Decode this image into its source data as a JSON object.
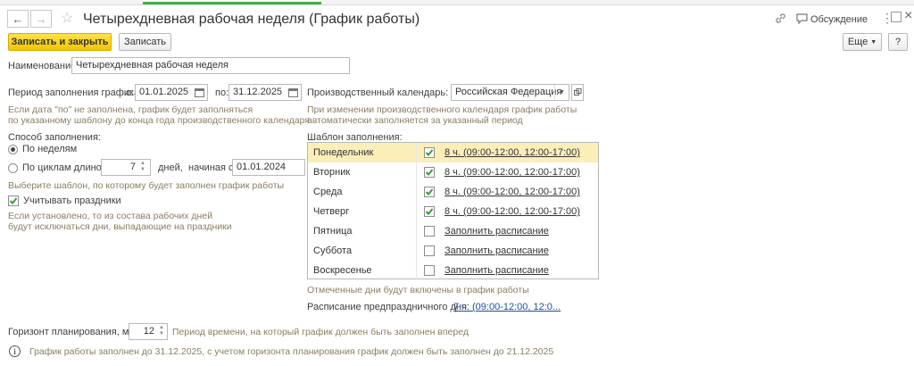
{
  "window": {
    "title": "Четырехдневная рабочая неделя (График работы)"
  },
  "header": {
    "discussion_label": "Обсуждение",
    "more_label": "Еще",
    "help_label": "?"
  },
  "toolbar": {
    "save_close_label": "Записать и закрыть",
    "save_label": "Записать"
  },
  "form": {
    "name_label": "Наименование:",
    "name_value": "Четырехдневная рабочая неделя",
    "period_label": "Период заполнения графика",
    "period_from_label": "с:",
    "period_from": "01.01.2025",
    "period_to_label": "по:",
    "period_to": "31.12.2025",
    "period_hint_1": "Если дата \"по\" не заполнена, график будет заполняться",
    "period_hint_2": "по указанному шаблону до конца года производственного календаря",
    "calendar_label": "Производственный календарь:",
    "calendar_value": "Российская Федерация",
    "calendar_hint_1": "При изменении производственного календаря график работы",
    "calendar_hint_2": "автоматически заполняется за указанный период",
    "method_label": "Способ заполнения:",
    "method_weeks": "По неделям",
    "method_cycles": "По циклам длиной",
    "cycle_length": "7",
    "cycle_days_label": "дней,",
    "cycle_start_label": "начиная с:",
    "cycle_start": "01.01.2024",
    "template_hint": "Выберите шаблон, по которому будет заполнен график работы",
    "holidays_label": "Учитывать праздники",
    "holidays_hint_1": "Если установлено, то из состава рабочих дней",
    "holidays_hint_2": "будут исключаться дни, выпадающие на праздники",
    "template_label": "Шаблон заполнения:",
    "marked_hint": "Отмеченные дни будут включены в график работы",
    "preholiday_label": "Расписание предпраздничного дня:",
    "preholiday_value": "7 ч. (09:00-12:00, 12:0...",
    "horizon_label": "Горизонт планирования, мес.:",
    "horizon_value": "12",
    "horizon_hint": "Период времени, на который график должен быть заполнен вперед",
    "info_text": "График работы заполнен до 31.12.2025, с учетом горизонта планирования график должен быть заполнен до 21.12.2025"
  },
  "schedule": [
    {
      "day": "Понедельник",
      "checked": true,
      "text": "8 ч. (09:00-12:00, 12:00-17:00)"
    },
    {
      "day": "Вторник",
      "checked": true,
      "text": "8 ч. (09:00-12:00, 12:00-17:00)"
    },
    {
      "day": "Среда",
      "checked": true,
      "text": "8 ч. (09:00-12:00, 12:00-17:00)"
    },
    {
      "day": "Четверг",
      "checked": true,
      "text": "8 ч. (09:00-12:00, 12:00-17:00)"
    },
    {
      "day": "Пятница",
      "checked": false,
      "text": "Заполнить расписание"
    },
    {
      "day": "Суббота",
      "checked": false,
      "text": "Заполнить расписание"
    },
    {
      "day": "Воскресенье",
      "checked": false,
      "text": "Заполнить расписание"
    }
  ],
  "colors": {
    "accent_yellow": "#f3c500",
    "check_green": "#3a9a3a",
    "hint": "#8a7d63",
    "link": "#1a4f9c"
  }
}
